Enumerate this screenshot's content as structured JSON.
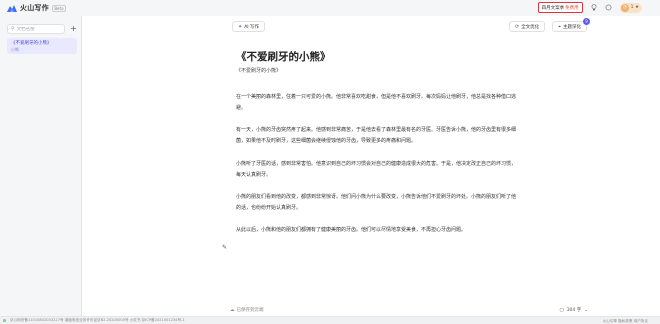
{
  "app": {
    "name": "火山写作",
    "beta": "Beta"
  },
  "topbar": {
    "vip_prefix": "四月文案季",
    "vip_highlight": "免费用",
    "user_label": "1 ★"
  },
  "sidebar": {
    "search_placeholder": "文档名搜",
    "items": [
      {
        "title": "《不爱刷牙的小熊》",
        "sub": "小熊"
      }
    ]
  },
  "toolbar": {
    "ai_label": "AI 写作",
    "full_polish": "全文优化",
    "theme_deep": "主题深化",
    "badge_count": "9"
  },
  "document": {
    "title": "《不爱刷牙的小熊》",
    "subtitle": "《不爱刷牙的小熊》",
    "paragraphs": [
      "在一个美丽的森林里，住着一只可爱的小熊。他非常喜欢吃甜食，但是他不喜欢刷牙。每次妈妈让他刷牙，他总是找各种借口逃避。",
      "有一天，小熊的牙齿突然疼了起来。他感到非常痛苦，于是他去看了森林里最有名的牙医。牙医告诉小熊，他的牙齿里有很多细菌，如果他不及时刷牙，这些细菌会继续侵蚀他的牙齿，导致更多的疼痛和问题。",
      "小熊听了牙医的话，感到非常害怕。他意识到自己的坏习惯会对自己的健康造成很大的危害。于是，他决定改正自己的坏习惯，每天认真刷牙。",
      "小熊的朋友们看到他的改变，都感到非常惊讶。他们问小熊为什么要改变，小熊告诉他们不爱刷牙的坏处。小熊的朋友们听了他的话，也纷纷开始认真刷牙。",
      "从此以后，小熊和他的朋友们都拥有了健康美丽的牙齿。他们可以尽情地享受美食，不再担心牙齿问题。"
    ]
  },
  "bottom": {
    "left_label": "已保存到云端",
    "word_count": "304 字"
  },
  "footer": {
    "left": "京公网安备11010802033227号  增值电信业务许可证京B2-20200000号 小红书  京ICP备2021001234号-1",
    "right": "火山引擎  隐私政策  用户协议"
  }
}
